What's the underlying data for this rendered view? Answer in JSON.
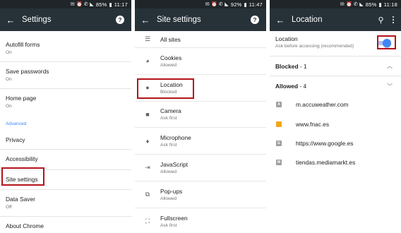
{
  "status": {
    "p1": {
      "battery": "85%",
      "time": "11:17"
    },
    "p2": {
      "battery": "92%",
      "time": "11:47"
    },
    "p3": {
      "battery": "85%",
      "time": "11:18"
    }
  },
  "colors": {
    "appbar": "#263238",
    "statusbar": "#1f2528",
    "accent": "#4285f4",
    "highlight": "#b3131b"
  },
  "settings": {
    "title": "Settings",
    "autofill": {
      "label": "Autofill forms",
      "sub": "On"
    },
    "save_passwords": {
      "label": "Save passwords",
      "sub": "On"
    },
    "home_page": {
      "label": "Home page",
      "sub": "On"
    },
    "advanced_header": "Advanced",
    "privacy": {
      "label": "Privacy"
    },
    "accessibility": {
      "label": "Accessibility"
    },
    "site_settings": {
      "label": "Site settings"
    },
    "data_saver": {
      "label": "Data Saver",
      "sub": "Off"
    },
    "about": {
      "label": "About Chrome"
    }
  },
  "site_settings": {
    "title": "Site settings",
    "items": [
      {
        "label": "All sites",
        "icon": "list-icon"
      },
      {
        "label": "Cookies",
        "sub": "Allowed",
        "icon": "cookie-icon"
      },
      {
        "label": "Location",
        "sub": "Blocked",
        "icon": "location-pin-icon"
      },
      {
        "label": "Camera",
        "sub": "Ask first",
        "icon": "camera-icon"
      },
      {
        "label": "Microphone",
        "sub": "Ask first",
        "icon": "microphone-icon"
      },
      {
        "label": "JavaScript",
        "sub": "Allowed",
        "icon": "javascript-icon"
      },
      {
        "label": "Pop-ups",
        "sub": "Allowed",
        "icon": "popup-icon"
      },
      {
        "label": "Fullscreen",
        "sub": "Ask first",
        "icon": "fullscreen-icon"
      }
    ]
  },
  "location": {
    "title": "Location",
    "toggle_label": "Location",
    "toggle_sub": "Ask before accessing (recommended)",
    "toggle_on": true,
    "blocked_label": "Blocked",
    "blocked_count": "- 1",
    "allowed_label": "Allowed",
    "allowed_count": "- 4",
    "sites": [
      {
        "url": "m.accuweather.com",
        "favicon": "A",
        "color": "#9e9e9e"
      },
      {
        "url": "www.fnac.es",
        "favicon": "",
        "color": "#f0a818"
      },
      {
        "url": "https://www.google.es",
        "favicon": "G",
        "color": "#9e9e9e"
      },
      {
        "url": "tiendas.mediamarkt.es",
        "favicon": "M",
        "color": "#9e9e9e"
      }
    ]
  }
}
